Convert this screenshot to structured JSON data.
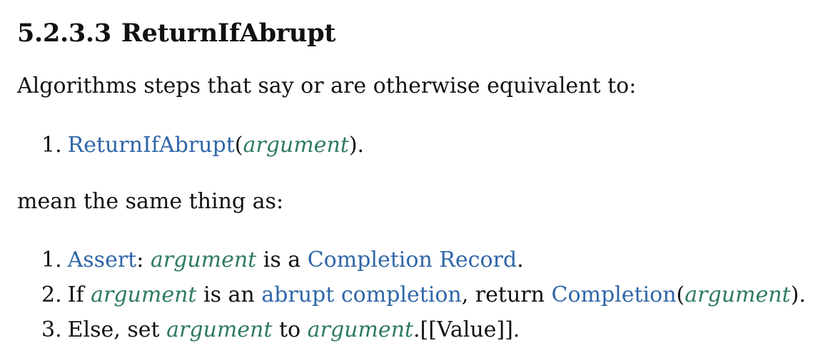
{
  "heading": {
    "number": "5.2.3.3",
    "title": "ReturnIfAbrupt"
  },
  "intro": "Algorithms steps that say or are otherwise equivalent to:",
  "example_step": {
    "number": "1.",
    "fn": "ReturnIfAbrupt",
    "open": "(",
    "arg": "argument",
    "close": ")."
  },
  "meaning": "mean the same thing as:",
  "steps": [
    {
      "number": "1.",
      "link1": "Assert",
      "t1": ": ",
      "var1": "argument",
      "t2": " is a ",
      "link2": "Completion Record",
      "t3": "."
    },
    {
      "number": "2.",
      "t1": "If ",
      "var1": "argument",
      "t2": " is an ",
      "link1": "abrupt completion",
      "t3": ", return ",
      "link2": "Completion",
      "t4": "(",
      "var2": "argument",
      "t5": ")."
    },
    {
      "number": "3.",
      "t1": "Else, set ",
      "var1": "argument",
      "t2": " to ",
      "var2": "argument",
      "t3": ".[[Value]]."
    }
  ],
  "colors": {
    "link": "#2f66a8",
    "variable": "#2d7a63",
    "text": "#111111"
  }
}
